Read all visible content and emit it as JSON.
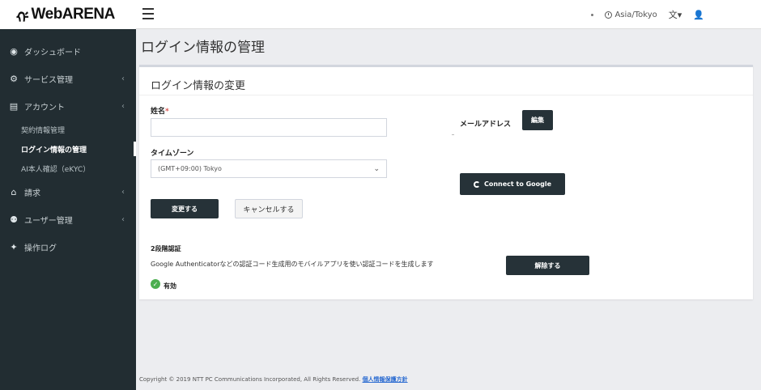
{
  "header": {
    "logo_mark": "ᡤ",
    "logo_text": "WebARENA",
    "timezone": "Asia/Tokyo",
    "lang_label": "文▾",
    "user_label": "👤"
  },
  "sidebar": {
    "items": [
      {
        "label": "ダッシュボード",
        "icon": "dashboard-icon",
        "glyph": "◉"
      },
      {
        "label": "サービス管理",
        "icon": "gears-icon",
        "glyph": "⚙",
        "chevron": "‹"
      },
      {
        "label": "アカウント",
        "icon": "id-card-icon",
        "glyph": "▤",
        "chevron": "‹"
      }
    ],
    "sub_items": [
      {
        "label": "契約情報管理"
      },
      {
        "label": "ログイン情報の管理"
      },
      {
        "label": "AI本人確認（eKYC）"
      }
    ],
    "items2": [
      {
        "label": "請求",
        "icon": "bank-icon",
        "glyph": "⌂",
        "chevron": "‹"
      },
      {
        "label": "ユーザー管理",
        "icon": "users-icon",
        "glyph": "⚉",
        "chevron": "‹"
      },
      {
        "label": "操作ログ",
        "icon": "log-icon",
        "glyph": "✦"
      }
    ]
  },
  "main": {
    "page_title": "ログイン情報の管理",
    "card_title": "ログイン情報の変更",
    "name_label": "姓名",
    "required_mark": "*",
    "name_value": "",
    "timezone_label": "タイムゾーン",
    "timezone_value": "(GMT+09:00) Tokyo",
    "email_label": "メールアドレス",
    "edit_button": "編集",
    "google_button": "Connect to Google",
    "change_button": "変更する",
    "cancel_button": "キャンセルする",
    "twofa_title": "2段階認証",
    "twofa_desc": "Google Authenticatorなどの認証コード生成用のモバイルアプリを使い認証コードを生成します",
    "disable_button": "解除する",
    "status_enabled": "有効"
  },
  "footer": {
    "copyright": "Copyright © 2019 NTT PC Communications Incorporated, All Rights Reserved.",
    "privacy_link": "個人情報保護方針"
  }
}
